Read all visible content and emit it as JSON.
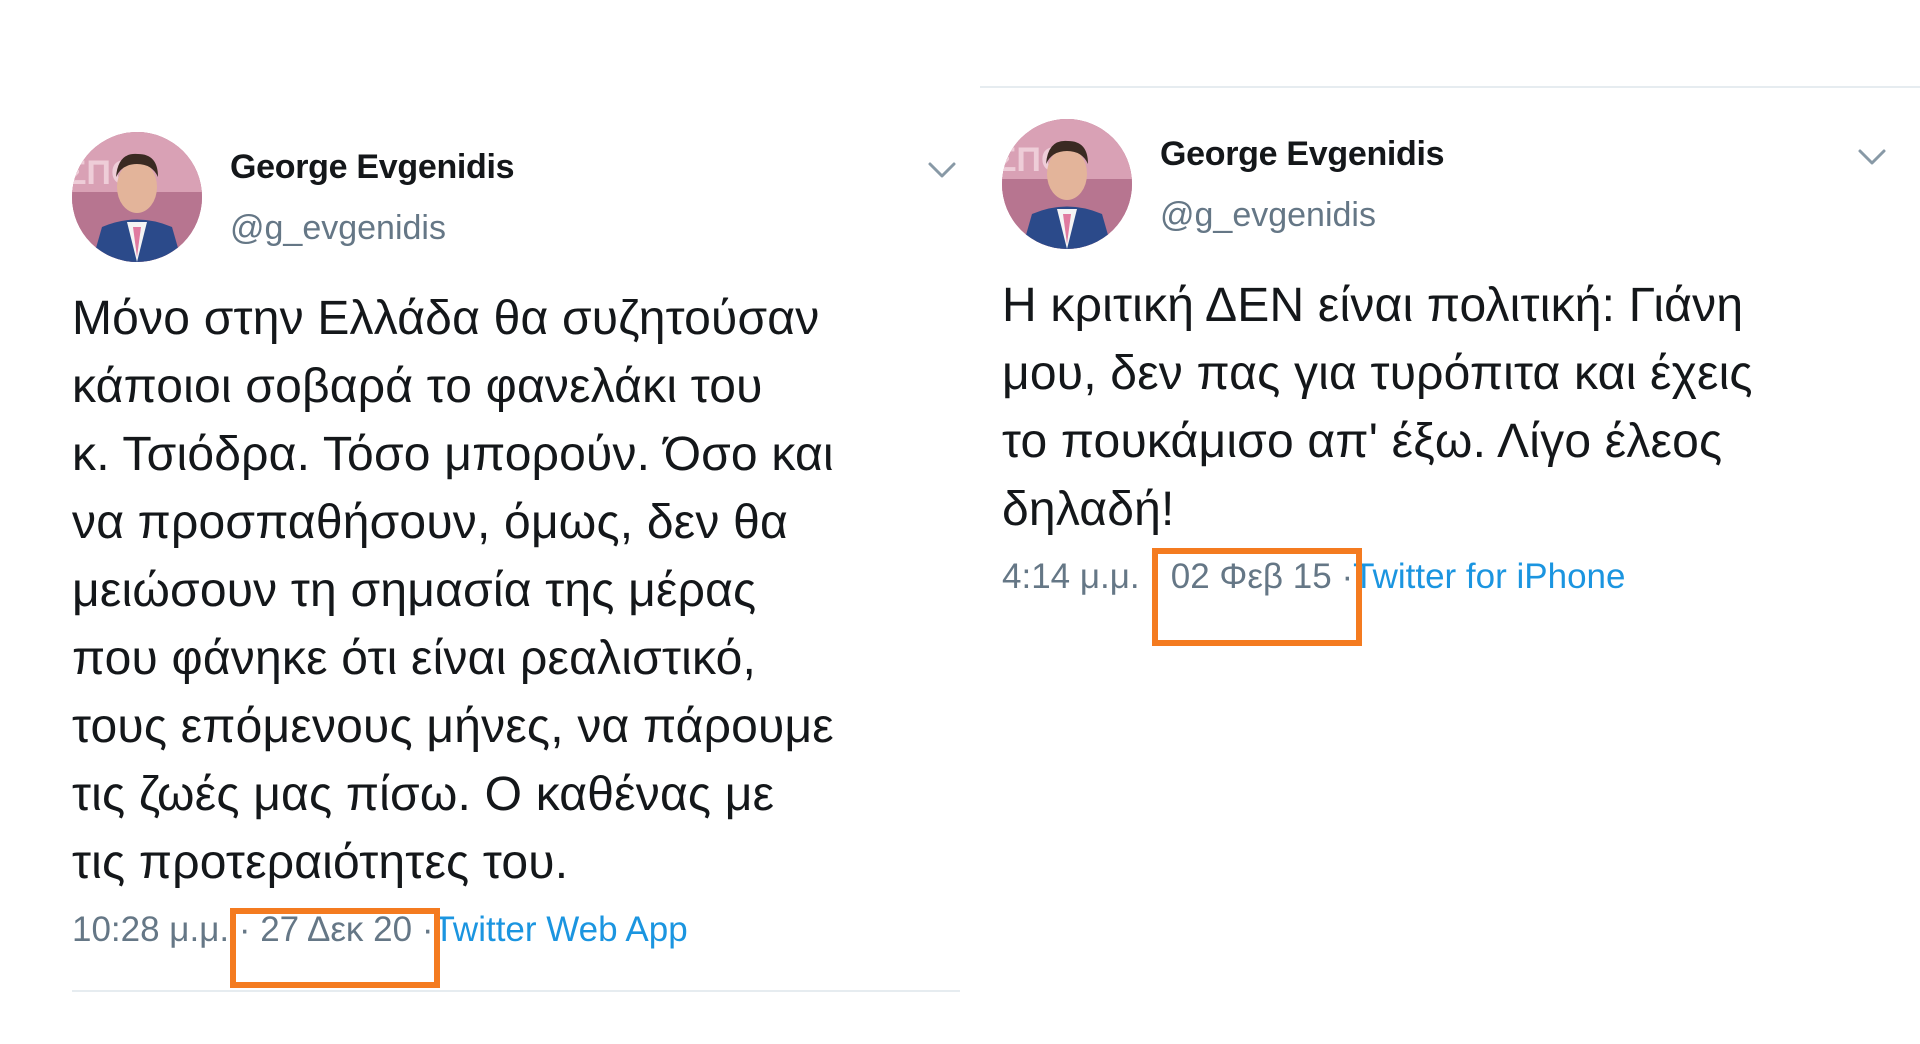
{
  "tweets": [
    {
      "user": {
        "name": "George Evgenidis",
        "handle": "@g_evgenidis"
      },
      "text": "Μόνο στην Ελλάδα θα συζητούσαν\nκάποιοι σοβαρά το φανελάκι του\nκ. Τσιόδρα. Τόσο μπορούν. Όσο και\nνα προσπαθήσουν, όμως, δεν θα\nμειώσουν τη σημασία της μέρας\nπου φάνηκε ότι είναι ρεαλιστικό,\nτους επόμενους μήνες, να πάρουμε\nτις ζωές μας πίσω. Ο καθένας με\nτις προτεραιότητες του.",
      "time": "10:28 μ.μ.",
      "date": "27 Δεκ 20",
      "source": "Twitter Web App"
    },
    {
      "user": {
        "name": "George Evgenidis",
        "handle": "@g_evgenidis"
      },
      "text": "Η κριτική ΔΕΝ είναι πολιτική: Γιάνη\nμου, δεν πας για τυρόπιτα και έχεις\nτο πουκάμισο απ' έξω. Λίγο έλεος\nδηλαδή!",
      "time": "4:14 μ.μ.",
      "date": "02 Φεβ 15",
      "source": "Twitter for iPhone"
    }
  ],
  "separator": "·",
  "icons": {
    "caret": "chevron-down-icon",
    "avatar": "avatar"
  },
  "colors": {
    "text": "#14171a",
    "muted": "#657786",
    "link": "#1b95e0",
    "highlight": "#f47b20",
    "divider": "#e6ecf0"
  }
}
